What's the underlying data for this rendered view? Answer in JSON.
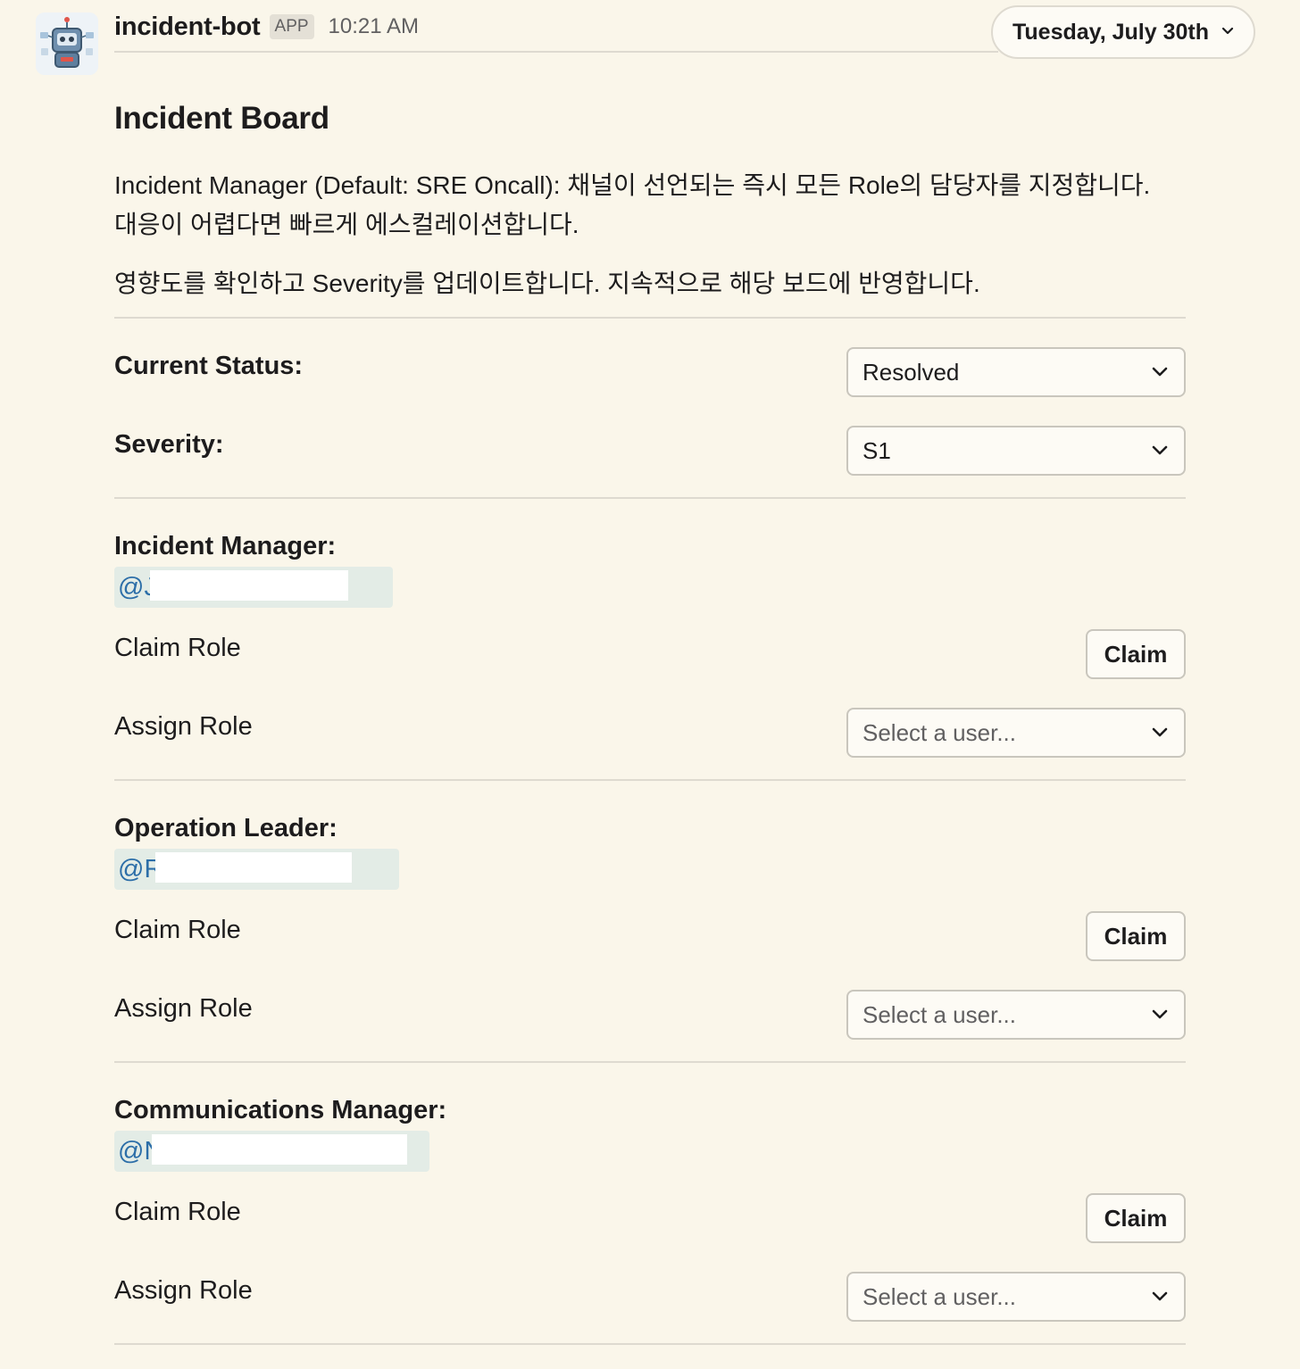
{
  "header": {
    "bot_name": "incident-bot",
    "badge": "APP",
    "time": "10:21 AM",
    "date_label": "Tuesday, July 30th"
  },
  "board": {
    "title": "Incident Board",
    "description_line1": "Incident Manager (Default: SRE Oncall): 채널이 선언되는 즉시 모든 Role의 담당자를 지정합니다.",
    "description_line2": "대응이 어렵다면 빠르게 에스컬레이션합니다.",
    "description_line3": "영향도를 확인하고 Severity를 업데이트합니다. 지속적으로 해당 보드에 반영합니다.",
    "status_label": "Current Status:",
    "status_value": "Resolved",
    "severity_label": "Severity:",
    "severity_value": "S1"
  },
  "roles": [
    {
      "title": "Incident Manager:",
      "mention": "@J                          ark",
      "claim_label": "Claim Role",
      "claim_button": "Claim",
      "assign_label": "Assign Role",
      "assign_placeholder": "Select a user..."
    },
    {
      "title": "Operation Leader:",
      "mention": "@R                            Lee",
      "claim_label": "Claim Role",
      "claim_button": "Claim",
      "assign_label": "Assign Role",
      "assign_placeholder": "Select a user..."
    },
    {
      "title": "Communications Manager:",
      "mention": "@N                                 in",
      "claim_label": "Claim Role",
      "claim_button": "Claim",
      "assign_label": "Assign Role",
      "assign_placeholder": "Select a user..."
    }
  ],
  "icons": {
    "avatar": "robot-avatar-icon",
    "dropdown": "chevron-down-icon"
  }
}
